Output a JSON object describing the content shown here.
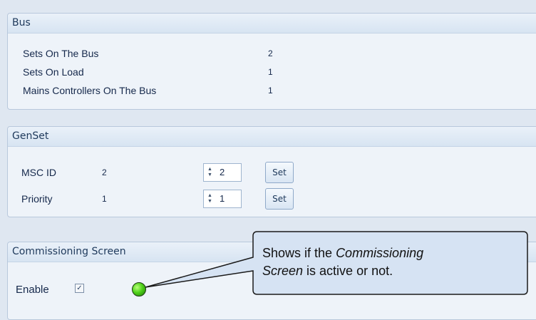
{
  "bus": {
    "title": "Bus",
    "rows": [
      {
        "label": "Sets On The Bus",
        "value": "2"
      },
      {
        "label": "Sets On Load",
        "value": "1"
      },
      {
        "label": "Mains Controllers On The Bus",
        "value": "1"
      }
    ]
  },
  "genset": {
    "title": "GenSet",
    "rows": [
      {
        "label": "MSC ID",
        "value": "2",
        "spin_value": "2",
        "button": "Set"
      },
      {
        "label": "Priority",
        "value": "1",
        "spin_value": "1",
        "button": "Set"
      }
    ]
  },
  "commissioning": {
    "title": "Commissioning Screen",
    "enable_label": "Enable",
    "enable_checked": true,
    "led_color": "#4fd11a"
  },
  "callout": {
    "text_before": "Shows if the ",
    "text_emphasis_1": "Commissioning",
    "text_emphasis_2": "Screen",
    "text_after": " is active or not."
  },
  "colors": {
    "background": "#dfe7f1",
    "panel": "#eef3f9",
    "header_text": "#1e395b",
    "callout_fill": "#d6e3f3"
  }
}
